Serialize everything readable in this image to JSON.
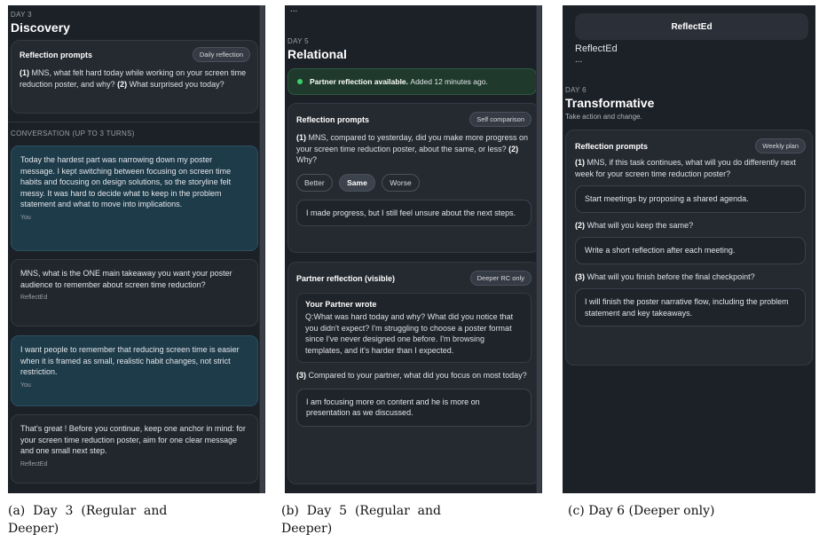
{
  "panel_a": {
    "day_tag": "DAY 3",
    "day_title": "Discovery",
    "card_title": "Reflection prompts",
    "pill": "Daily reflection",
    "q1_num": "(1)",
    "q1_text": "MNS, what felt hard today while working on your screen time reduction poster, and why?",
    "q2_num": "(2)",
    "q2_text": "What surprised you today?",
    "conversation_label": "CONVERSATION (UP TO 3 TURNS)",
    "messages": [
      {
        "text": "Today the hardest part was narrowing down my poster message. I kept switching between focusing on screen time habits and focusing on design solutions, so the storyline felt messy. It was hard to decide what to keep in the problem statement and what to move into implications.",
        "who": "You"
      },
      {
        "text": "MNS, what is the ONE main takeaway you want your poster audience to remember about screen time reduction?",
        "who": "ReflectEd"
      },
      {
        "text": "I want people to remember that reducing screen time is easier when it is framed as small, realistic habit changes, not strict restriction.",
        "who": "You"
      },
      {
        "text": "That's great ! Before you continue, keep one anchor in mind: for your screen time reduction poster, aim for one clear message and one small next step.",
        "who": "ReflectEd"
      }
    ]
  },
  "panel_b": {
    "ellipsis": "...",
    "day_tag": "DAY 5",
    "day_title": "Relational",
    "banner_bold": "Partner reflection available.",
    "banner_rest": "Added 12 minutes ago.",
    "card_title": "Reflection prompts",
    "pill": "Self comparison",
    "q1_num": "(1)",
    "q1_text": "MNS, compared to yesterday, did you make more progress on your screen time reduction poster, about the same, or less?",
    "q2_num": "(2)",
    "q2_text": "Why?",
    "choices": [
      "Better",
      "Same",
      "Worse"
    ],
    "answer1": "I made progress, but I still feel unsure about the next steps.",
    "partner_title": "Partner reflection (visible)",
    "partner_pill": "Deeper RC only",
    "partner_wrote": "Your Partner wrote",
    "partner_text": "Q:What was hard today and why? What did you notice that you didn't expect? I'm struggling to choose a poster format since I've never designed one before. I'm browsing templates, and it's harder than I expected.",
    "q3_num": "(3)",
    "q3_text": "Compared to your partner, what did you focus on most today?",
    "answer3": "I am focusing more on content and he is more on presentation as we discussed."
  },
  "panel_c": {
    "header_title": "ReflectEd",
    "brand_line": "ReflectEd",
    "ellipsis": "...",
    "day_tag": "DAY 6",
    "day_title": "Transformative",
    "subtitle": "Take action and change.",
    "card_title": "Reflection prompts",
    "pill": "Weekly plan",
    "q1_num": "(1)",
    "q1_text": "MNS, if this task continues, what will you do differently next week for your screen time reduction poster?",
    "a1": "Start meetings by proposing a shared agenda.",
    "q2_num": "(2)",
    "q2_text": "What will you keep the same?",
    "a2": "Write a short reflection after each meeting.",
    "q3_num": "(3)",
    "q3_text": "What will you finish before the final checkpoint?",
    "a3": "I will finish the poster narrative flow, including the problem statement and key takeaways."
  },
  "captions": {
    "a_line1": "(a)  Day  3  (Regular  and",
    "a_line2": "Deeper)",
    "b_line1": "(b)  Day  5  (Regular  and",
    "b_line2": "Deeper)",
    "c_line1": "(c) Day 6 (Deeper only)"
  },
  "colors": {
    "panel_bg": "#1c2027",
    "card_bg": "#252a31",
    "user_bubble": "#1e3b4a",
    "partner_banner": "#1f3a2c",
    "status_dot": "#3ccf6a"
  }
}
